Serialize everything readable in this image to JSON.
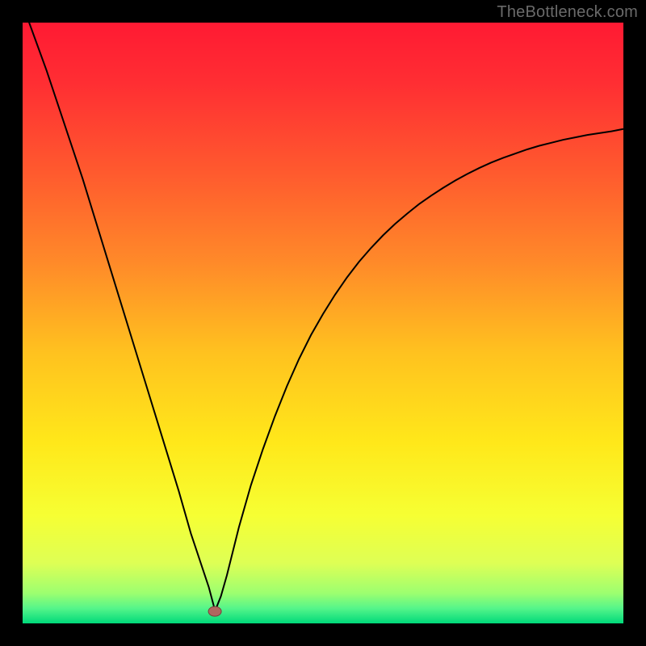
{
  "attribution": "TheBottleneck.com",
  "colors": {
    "frame": "#000000",
    "gradient_stops": [
      {
        "offset": 0.0,
        "color": "#ff1a33"
      },
      {
        "offset": 0.1,
        "color": "#ff2e33"
      },
      {
        "offset": 0.25,
        "color": "#ff5a2e"
      },
      {
        "offset": 0.4,
        "color": "#ff8a29"
      },
      {
        "offset": 0.55,
        "color": "#ffc21f"
      },
      {
        "offset": 0.7,
        "color": "#ffe81a"
      },
      {
        "offset": 0.82,
        "color": "#f6ff33"
      },
      {
        "offset": 0.9,
        "color": "#deff55"
      },
      {
        "offset": 0.95,
        "color": "#9cff70"
      },
      {
        "offset": 0.975,
        "color": "#55f58a"
      },
      {
        "offset": 1.0,
        "color": "#00d97a"
      }
    ],
    "curve": "#000000",
    "marker_fill": "#b0675f",
    "marker_stroke": "#7a3f3a"
  },
  "chart_data": {
    "type": "line",
    "title": "",
    "xlabel": "",
    "ylabel": "",
    "xlim": [
      0,
      100
    ],
    "ylim": [
      0,
      100
    ],
    "grid": false,
    "min_marker": {
      "x": 32,
      "y": 2
    },
    "series": [
      {
        "name": "curve",
        "x": [
          0,
          2,
          4,
          6,
          8,
          10,
          12,
          14,
          16,
          18,
          20,
          22,
          24,
          26,
          28,
          29,
          30,
          31,
          31.8,
          32,
          33,
          34,
          36,
          38,
          40,
          42,
          44,
          46,
          48,
          50,
          52,
          54,
          56,
          58,
          60,
          62,
          64,
          66,
          68,
          70,
          72,
          74,
          76,
          78,
          80,
          82,
          84,
          86,
          88,
          90,
          92,
          94,
          96,
          98,
          100
        ],
        "y": [
          103,
          97.5,
          92,
          86,
          80,
          74,
          67.5,
          61,
          54.5,
          48,
          41.5,
          35,
          28.5,
          22,
          15,
          12,
          9,
          6,
          3,
          2,
          4.5,
          8,
          16,
          23,
          29,
          34.5,
          39.5,
          44,
          48,
          51.5,
          54.7,
          57.6,
          60.2,
          62.5,
          64.6,
          66.5,
          68.2,
          69.8,
          71.2,
          72.5,
          73.7,
          74.8,
          75.8,
          76.7,
          77.5,
          78.2,
          78.9,
          79.5,
          80.0,
          80.5,
          80.9,
          81.3,
          81.6,
          81.9,
          82.3
        ]
      }
    ]
  }
}
